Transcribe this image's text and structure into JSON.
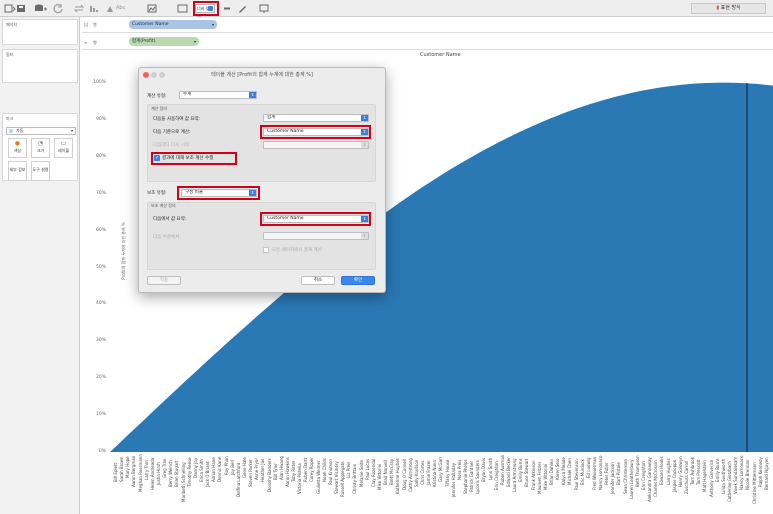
{
  "toolbar": {
    "fit_value": "너비 맞추기",
    "undo_label": "Abc",
    "show_me_label": "표현 방식",
    "icons": [
      "tableau-logo-icon",
      "save-icon",
      "add-datasource-icon",
      "refresh-icon",
      "swap-icon",
      "sort-icon",
      "highlight-icon",
      "group-icon",
      "label-icon",
      "fit-icon",
      "pin-icon",
      "presentation-icon"
    ]
  },
  "left_panel": {
    "pages_title": "페이지",
    "filters_title": "필터",
    "marks_title": "마크",
    "mark_type": "자동",
    "mark_buttons": [
      {
        "label": "색상",
        "icon": "color-icon"
      },
      {
        "label": "크기",
        "icon": "size-icon"
      },
      {
        "label": "레이블",
        "icon": "label-icon"
      },
      {
        "label": "세부 정보",
        "icon": "detail-icon"
      },
      {
        "label": "도구 설명",
        "icon": "tooltip-icon"
      }
    ]
  },
  "shelves": {
    "columns_label": "열",
    "columns_pill": "Customer Name",
    "rows_label": "행",
    "rows_pill": "합계(Profit)"
  },
  "viz": {
    "title": "Customer Name",
    "y_axis_label": "Profit의 합계 누계에 대한 총계 %",
    "y_ticks": [
      "100%",
      "90%",
      "80%",
      "70%",
      "60%",
      "50%",
      "40%",
      "30%",
      "20%",
      "10%",
      "0%"
    ],
    "area_color": "#2a78b4",
    "customer_names": [
      "Bill Eplett",
      "Sarah Brown",
      "Mary Hope",
      "Aaron Bergman",
      "Meghan Rossmann",
      "Larry Tron",
      "Helen Andreada",
      "Justin Hirsh",
      "Greg Tran",
      "Berry Weirich",
      "Brian Stugart",
      "Maribeth Schnelling",
      "Timothy Reese",
      "Danny Joy",
      "Erica Smith",
      "Jack O'Briant",
      "Adrian Hane",
      "Dennis Kane",
      "Roy Phan",
      "Joy Bell",
      "Delfina Latchford",
      "Gene Hale",
      "Steven Parker",
      "Anne Pryor",
      "Heather Jas",
      "Dorothy Badders",
      "Bill Tyler",
      "Alan Hwang",
      "Aaron Hawkins",
      "Toby Ritter",
      "Victoria Pisteka",
      "Ruben Dartt",
      "Corey Roper",
      "Giulietta Weimer",
      "Noah Childs",
      "Paul Knutson",
      "Stewart Visinsky",
      "Russell Applegate",
      "Liz Preis",
      "Christy Brittain",
      "Melanie Seite",
      "Paul Lucas",
      "Clay Rozendal",
      "Mike Vittorini",
      "Brad Norvell",
      "Brett McCray",
      "Katherine Hughes",
      "Doug O'Connell",
      "Cathy Armstrong",
      "Sally Knutson",
      "Chris Cortes",
      "Jamie Frazer",
      "Kristina Nunn",
      "Gary McGarr",
      "Tiffany House",
      "Jennifer Halladay",
      "Nora Preis",
      "Stephanie Phelps",
      "Patrick Gardner",
      "Lycoris Saunders",
      "Bryan Davis",
      "Lynn Smith",
      "Erin Creighton",
      "Ruben Ausman",
      "Edward Becker",
      "Laura Armstrong",
      "Emily Burns",
      "Bruce Stewart",
      "Frank Atkinson",
      "Maureen Fritzler",
      "Mike Vittorini",
      "Brian Dahlen",
      "Karen Seio",
      "Kalyca Meade",
      "Michael Chen",
      "Paul Stevenson",
      "Eric Murdock",
      "Ed Ludwig",
      "Fred Wasserman",
      "Nancy Lomonaco",
      "Peter Fuller",
      "Jennifer Jackson",
      "Bart Pistole",
      "Sean Christensen",
      "Lauren Leatherbury",
      "Beth Thompson",
      "Erin Creighton",
      "Aleksandra Gannaway",
      "Charles McCrossin",
      "Edward Hooks",
      "Larry Hughes",
      "Jasper Cacioppo",
      "Henry Goldwyn",
      "Zuschuss Carroll",
      "Tom Ashbrook",
      "Tom Prescott",
      "Matt Hagelstein",
      "Anthony Garverick",
      "Emily Burns",
      "Linda Southworth",
      "Catherine Glotzbach",
      "Vivek Sundaresam",
      "Nancy Lomonaco",
      "Nicole Brennan",
      "Christine Mittlemann",
      "Ralph Kennedy",
      "Bernard Nguyen"
    ]
  },
  "dialog": {
    "title": "테이블 계산 [Profit의 합계 누계에 대한 총계 %]",
    "calc_type_label": "계산 유형:",
    "calc_type_value": "누계",
    "calc_def_label": "계산 정의",
    "summarize_label": "다음을 사용하여 값 요약:",
    "summarize_value": "합계",
    "compute_using_label": "다음 기준으로 계산:",
    "compute_using_value": "Customer Name",
    "restart_label": "다음마다 다시 시작:",
    "secondary_check_label": "결과에 대해 보조 계산 수행",
    "secondary_type_label": "보조 유형:",
    "secondary_type_value": "구성 비율",
    "secondary_def_label": "보조 계산 정의",
    "secondary_summarize_label": "다음에서 값 요약:",
    "secondary_summarize_value": "Customer Name",
    "at_level_label": "다음 수준에서:",
    "all_pages_label": "모든 페이지에서 총계 계산",
    "apply_label": "적용",
    "cancel_label": "취소",
    "ok_label": "확인"
  },
  "colors": {
    "highlight": "#d0021b",
    "accent_blue": "#3b7de0",
    "column_pill": "#a9c4e6",
    "row_pill": "#b7dbae"
  }
}
